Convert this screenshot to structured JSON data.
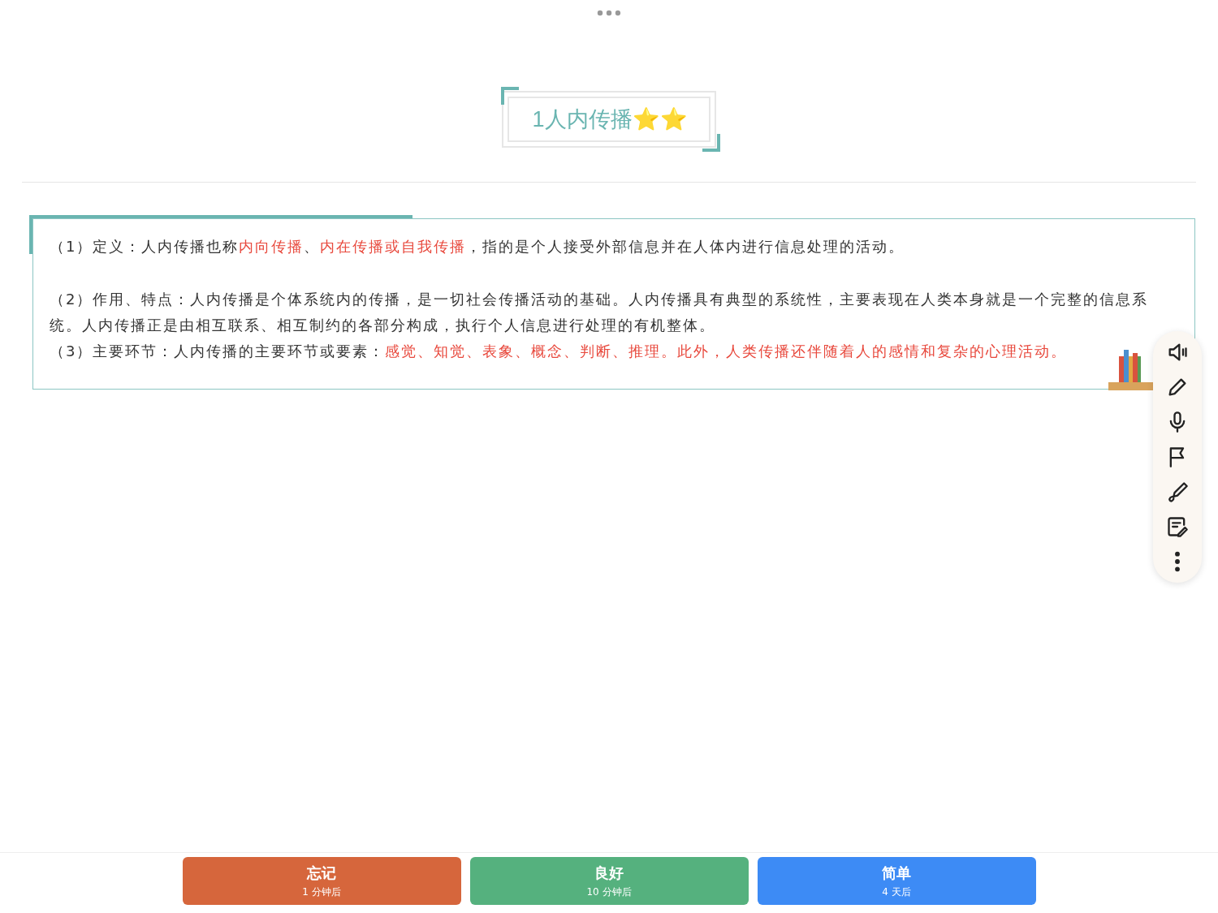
{
  "title": {
    "text": "1人内传播⭐⭐"
  },
  "paragraphs": [
    {
      "kind": "text",
      "runs": [
        {
          "text": "（1）定义：人内传播也称",
          "highlight": false
        },
        {
          "text": "内向传播",
          "highlight": true
        },
        {
          "text": "、",
          "highlight": false
        },
        {
          "text": "内在传播或自我传播",
          "highlight": true
        },
        {
          "text": "，指的是个人接受外部信息并在人体内进行信息处理的活动。",
          "highlight": false
        }
      ]
    },
    {
      "kind": "blank"
    },
    {
      "kind": "text",
      "runs": [
        {
          "text": "（2）作用、特点：人内传播是个体系统内的传播，是一切社会传播活动的基础。人内传播具有典型的系统性，主要表现在人类本身就是一个完整的信息系统。人内传播正是由相互联系、相互制约的各部分构成，执行个人信息进行处理的有机整体。",
          "highlight": false
        }
      ]
    },
    {
      "kind": "text",
      "runs": [
        {
          "text": "（3）主要环节：人内传播的主要环节或要素：",
          "highlight": false
        },
        {
          "text": "感觉、知觉、表象、概念、判断、推理。此外，人类传播还伴随着人的感情和复杂的心理活动。",
          "highlight": true
        }
      ]
    }
  ],
  "tools": [
    {
      "kind": "speaker"
    },
    {
      "kind": "pencil"
    },
    {
      "kind": "microphone"
    },
    {
      "kind": "flag"
    },
    {
      "kind": "pen"
    },
    {
      "kind": "note"
    },
    {
      "kind": "more"
    }
  ],
  "answers": [
    {
      "label": "忘记",
      "interval": "1 分钟后",
      "color": "#d6663c"
    },
    {
      "label": "良好",
      "interval": "10 分钟后",
      "color": "#55b17e"
    },
    {
      "label": "简单",
      "interval": "4 天后",
      "color": "#3d8bf5"
    }
  ]
}
